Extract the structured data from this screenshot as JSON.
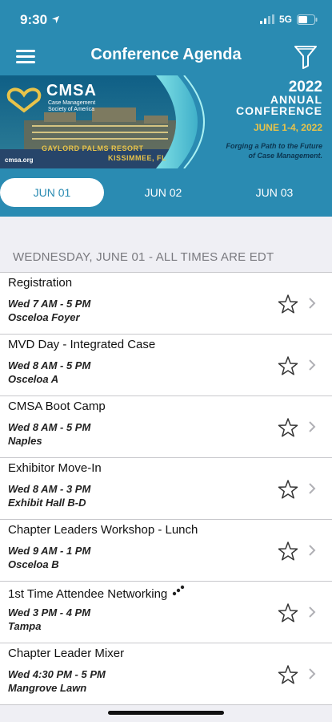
{
  "status": {
    "time": "9:30",
    "network": "5G"
  },
  "header": {
    "title": "Conference Agenda"
  },
  "banner": {
    "org_name": "CMSA",
    "org_tagline_1": "Case Management",
    "org_tagline_2": "Society of America",
    "website": "cmsa.org",
    "venue_1": "GAYLORD PALMS RESORT",
    "venue_2": "KISSIMMEE, FL",
    "year": "2022",
    "event_line_1": "ANNUAL",
    "event_line_2": "CONFERENCE",
    "dates": "JUNE 1-4, 2022",
    "slogan_1": "Forging a Path to the Future",
    "slogan_2": "of Case Management."
  },
  "tabs": [
    {
      "label": "JUN 01",
      "active": true
    },
    {
      "label": "JUN 02",
      "active": false
    },
    {
      "label": "JUN 03",
      "active": false
    }
  ],
  "section_header": "WEDNESDAY, JUNE 01 - ALL TIMES ARE EDT",
  "sessions": [
    {
      "title": "Registration",
      "time": "Wed 7 AM - 5 PM",
      "room": "Osceloa Foyer"
    },
    {
      "title": "MVD Day - Integrated Case",
      "time": "Wed 8 AM - 5 PM",
      "room": "Osceloa A"
    },
    {
      "title": "CMSA Boot Camp",
      "time": "Wed 8 AM - 5 PM",
      "room": "Naples"
    },
    {
      "title": "Exhibitor Move-In",
      "time": "Wed 8 AM - 3 PM",
      "room": "Exhibit Hall B-D"
    },
    {
      "title": "Chapter Leaders Workshop - Lunch",
      "time": "Wed 9 AM - 1 PM",
      "room": "Osceloa B"
    },
    {
      "title": "1st Time Attendee Networking",
      "time": "Wed 3 PM - 4 PM",
      "room": "Tampa"
    },
    {
      "title": "Chapter Leader Mixer",
      "time": "Wed 4:30 PM - 5 PM",
      "room": "Mangrove Lawn"
    }
  ],
  "colors": {
    "brand": "#2a8bb2",
    "banner_teal": "#1a7ea0",
    "gold": "#e8c34a"
  },
  "icons": [
    "menu-icon",
    "filter-icon",
    "star-icon",
    "chevron-right-icon",
    "networking-icon"
  ]
}
